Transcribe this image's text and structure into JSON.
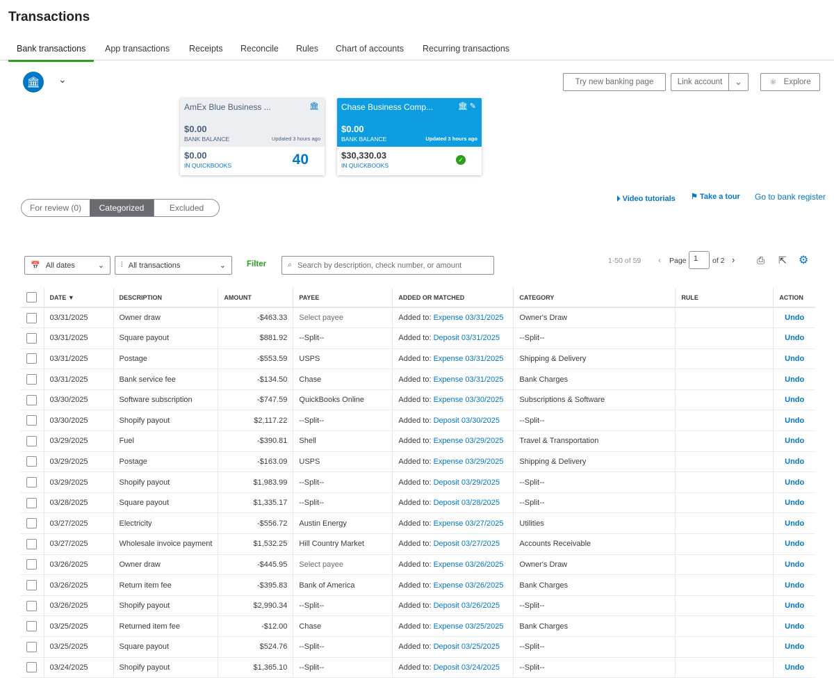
{
  "title": "Transactions",
  "tabs": [
    "Bank transactions",
    "App transactions",
    "Receipts",
    "Reconcile",
    "Rules",
    "Chart of accounts",
    "Recurring transactions"
  ],
  "buttons": {
    "try_new": "Try new banking page",
    "link_account": "Link account",
    "explore": "Explore"
  },
  "cards": [
    {
      "name": "AmEx Blue Business ...",
      "bank_balance": "$0.00",
      "bank_label": "BANK BALANCE",
      "updated": "Updated 3 hours ago",
      "qb_balance": "$0.00",
      "qb_label": "IN QUICKBOOKS",
      "count": "40"
    },
    {
      "name": "Chase Business Comp...",
      "bank_balance": "$0.00",
      "bank_label": "BANK BALANCE",
      "updated": "Updated 3 hours ago",
      "qb_balance": "$30,330.03",
      "qb_label": "IN QUICKBOOKS"
    }
  ],
  "segments": [
    "For review (0)",
    "Categorized",
    "Excluded"
  ],
  "links": {
    "video": "Video tutorials",
    "tour": "Take a tour",
    "register": "Go to bank register"
  },
  "filters": {
    "dates": "All dates",
    "types": "All transactions",
    "filter": "Filter",
    "search_placeholder": "Search by description, check number, or amount"
  },
  "pagination": {
    "range": "1-50 of 59",
    "page_label": "Page",
    "page": "1",
    "of": "of 2"
  },
  "colors": {
    "accent": "#0077c5",
    "green": "#2ca01c",
    "selected_card": "#0d9de0"
  },
  "columns": [
    "DATE ▼",
    "DESCRIPTION",
    "AMOUNT",
    "PAYEE",
    "ADDED OR MATCHED",
    "CATEGORY",
    "RULE",
    "ACTION"
  ],
  "added_prefix": "Added to:",
  "undo": "Undo",
  "rows": [
    [
      "03/31/2025",
      "Owner draw",
      "-$463.33",
      "Select payee",
      "Expense 03/31/2025",
      "Owner's Draw"
    ],
    [
      "03/31/2025",
      "Square payout",
      "$881.92",
      "--Split--",
      "Deposit 03/31/2025",
      "--Split--"
    ],
    [
      "03/31/2025",
      "Postage",
      "-$553.59",
      "USPS",
      "Expense 03/31/2025",
      "Shipping & Delivery"
    ],
    [
      "03/31/2025",
      "Bank service fee",
      "-$134.50",
      "Chase",
      "Expense 03/31/2025",
      "Bank Charges"
    ],
    [
      "03/30/2025",
      "Software subscription",
      "-$747.59",
      "QuickBooks Online",
      "Expense 03/30/2025",
      "Subscriptions & Software"
    ],
    [
      "03/30/2025",
      "Shopify payout",
      "$2,117.22",
      "--Split--",
      "Deposit 03/30/2025",
      "--Split--"
    ],
    [
      "03/29/2025",
      "Fuel",
      "-$390.81",
      "Shell",
      "Expense 03/29/2025",
      "Travel & Transportation"
    ],
    [
      "03/29/2025",
      "Postage",
      "-$163.09",
      "USPS",
      "Expense 03/29/2025",
      "Shipping & Delivery"
    ],
    [
      "03/29/2025",
      "Shopify payout",
      "$1,983.99",
      "--Split--",
      "Deposit 03/29/2025",
      "--Split--"
    ],
    [
      "03/28/2025",
      "Square payout",
      "$1,335.17",
      "--Split--",
      "Deposit 03/28/2025",
      "--Split--"
    ],
    [
      "03/27/2025",
      "Electricity",
      "-$556.72",
      "Austin Energy",
      "Expense 03/27/2025",
      "Utilities"
    ],
    [
      "03/27/2025",
      "Wholesale invoice payment",
      "$1,532.25",
      "Hill Country Market",
      "Deposit 03/27/2025",
      "Accounts Receivable"
    ],
    [
      "03/26/2025",
      "Owner draw",
      "-$445.95",
      "Select payee",
      "Expense 03/26/2025",
      "Owner's Draw"
    ],
    [
      "03/26/2025",
      "Return item fee",
      "-$395.83",
      "Bank of America",
      "Expense 03/26/2025",
      "Bank Charges"
    ],
    [
      "03/26/2025",
      "Shopify payout",
      "$2,990.34",
      "--Split--",
      "Deposit 03/26/2025",
      "--Split--"
    ],
    [
      "03/25/2025",
      "Returned item fee",
      "-$12.00",
      "Chase",
      "Expense 03/25/2025",
      "Bank Charges"
    ],
    [
      "03/25/2025",
      "Square payout",
      "$524.76",
      "--Split--",
      "Deposit 03/25/2025",
      "--Split--"
    ],
    [
      "03/24/2025",
      "Shopify payout",
      "$1,365.10",
      "--Split--",
      "Deposit 03/24/2025",
      "--Split--"
    ]
  ]
}
